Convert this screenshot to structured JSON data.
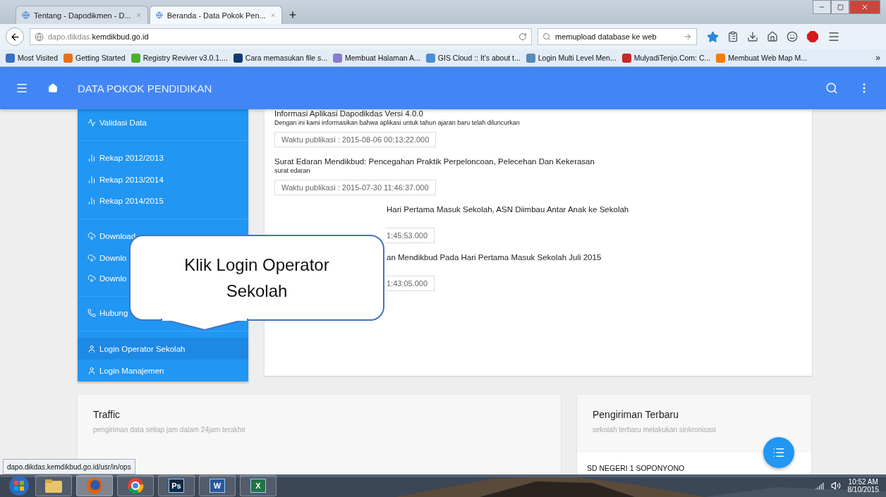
{
  "browser": {
    "tabs": [
      {
        "label": "Tentang - Dapodikmen - D...",
        "selected": false
      },
      {
        "label": "Beranda - Data Pokok Pen...",
        "selected": true
      }
    ],
    "url": "dapo.dikdas.**kemdikbud.go.id**",
    "search": "memupload database ke web",
    "bookmarks": [
      {
        "label": "Most Visited",
        "color": "#3a6fc4"
      },
      {
        "label": "Getting Started",
        "color": "#e8701a"
      },
      {
        "label": "Registry Reviver v3.0.1....",
        "color": "#4caf2a"
      },
      {
        "label": "Cara memasukan file s...",
        "color": "#123a6b"
      },
      {
        "label": "Membuat Halaman A...",
        "color": "#8a7bd0"
      },
      {
        "label": "GIS Cloud :: It's about t...",
        "color": "#4a8fd0"
      },
      {
        "label": "Login Multi Level Men...",
        "color": "#5a8ab8"
      },
      {
        "label": "MulyadiTenjo.Com: C...",
        "color": "#c62828"
      },
      {
        "label": "Membuat Web Map M...",
        "color": "#f57c00"
      }
    ],
    "overflow": "»"
  },
  "app": {
    "title": "DATA POKOK PENDIDIKAN",
    "sidebar": [
      {
        "kind": "validate",
        "label": "Validasi Data",
        "selected": false,
        "group_end": true
      },
      {
        "kind": "recap",
        "label": "Rekap 2012/2013",
        "selected": false,
        "group_end": false
      },
      {
        "kind": "recap",
        "label": "Rekap 2013/2014",
        "selected": false,
        "group_end": false
      },
      {
        "kind": "recap",
        "label": "Rekap 2014/2015",
        "selected": false,
        "group_end": true
      },
      {
        "kind": "download",
        "label": "Download",
        "selected": false,
        "group_end": false
      },
      {
        "kind": "download",
        "label": "Downlo",
        "selected": false,
        "group_end": false
      },
      {
        "kind": "download",
        "label": "Downlo",
        "selected": false,
        "group_end": true
      },
      {
        "kind": "phone",
        "label": "Hubung",
        "selected": false,
        "group_end": true
      },
      {
        "kind": "user",
        "label": "Login Operator Sekolah",
        "selected": true,
        "group_end": false
      },
      {
        "kind": "user",
        "label": "Login Manajemen",
        "selected": false,
        "group_end": false
      }
    ],
    "news": [
      {
        "title": "Informasi Aplikasi Dapodikdas Versi 4.0.0",
        "summary": "Dengan ini kami informasikan bahwa aplikasi untuk tahun ajaran baru telah diluncurkan",
        "time": "Waktu publikasi : 2015-08-06 00:13:22.000",
        "kind": "full"
      },
      {
        "title": "Surat Edaran Mendikbud: Pencegahan Praktik Perpeloncoan, Pelecehan Dan Kekerasan",
        "summary": "surat edaran",
        "time": "Waktu publikasi : 2015-07-30 11:46:37.000",
        "kind": "full"
      },
      {
        "title": "Hari Pertama Masuk Sekolah, ASN Diimbau Antar Anak ke Sekolah",
        "time": "1:45:53.000",
        "kind": "partial"
      },
      {
        "title": "an Mendikbud Pada Hari Pertama Masuk Sekolah Juli 2015",
        "time": "1:43:05.000",
        "kind": "partial"
      }
    ],
    "traffic": {
      "title": "Traffic",
      "subtitle": "pengiriman data setiap jam dalam 24jam terakhir"
    },
    "recent": {
      "title": "Pengiriman Terbaru",
      "subtitle": "sekolah terbaru melakukan sinkronisasi",
      "items": [
        "SD NEGERI 1 SOPONYONO"
      ]
    },
    "callout": "Klik Login Operator Sekolah"
  },
  "status_url": "dapo.dikdas.kemdikbud.go.id/usr/in/ops",
  "taskbar": {
    "apps": [
      {
        "kind": "explorer",
        "selected": false
      },
      {
        "kind": "firefox",
        "selected": true
      },
      {
        "kind": "chrome",
        "selected": false
      },
      {
        "kind": "ps",
        "glyph": "Ps",
        "selected": false
      },
      {
        "kind": "word",
        "glyph": "W",
        "selected": false
      },
      {
        "kind": "excel",
        "glyph": "X",
        "selected": false
      }
    ],
    "time": "10:52 AM",
    "date": "8/10/2015"
  }
}
